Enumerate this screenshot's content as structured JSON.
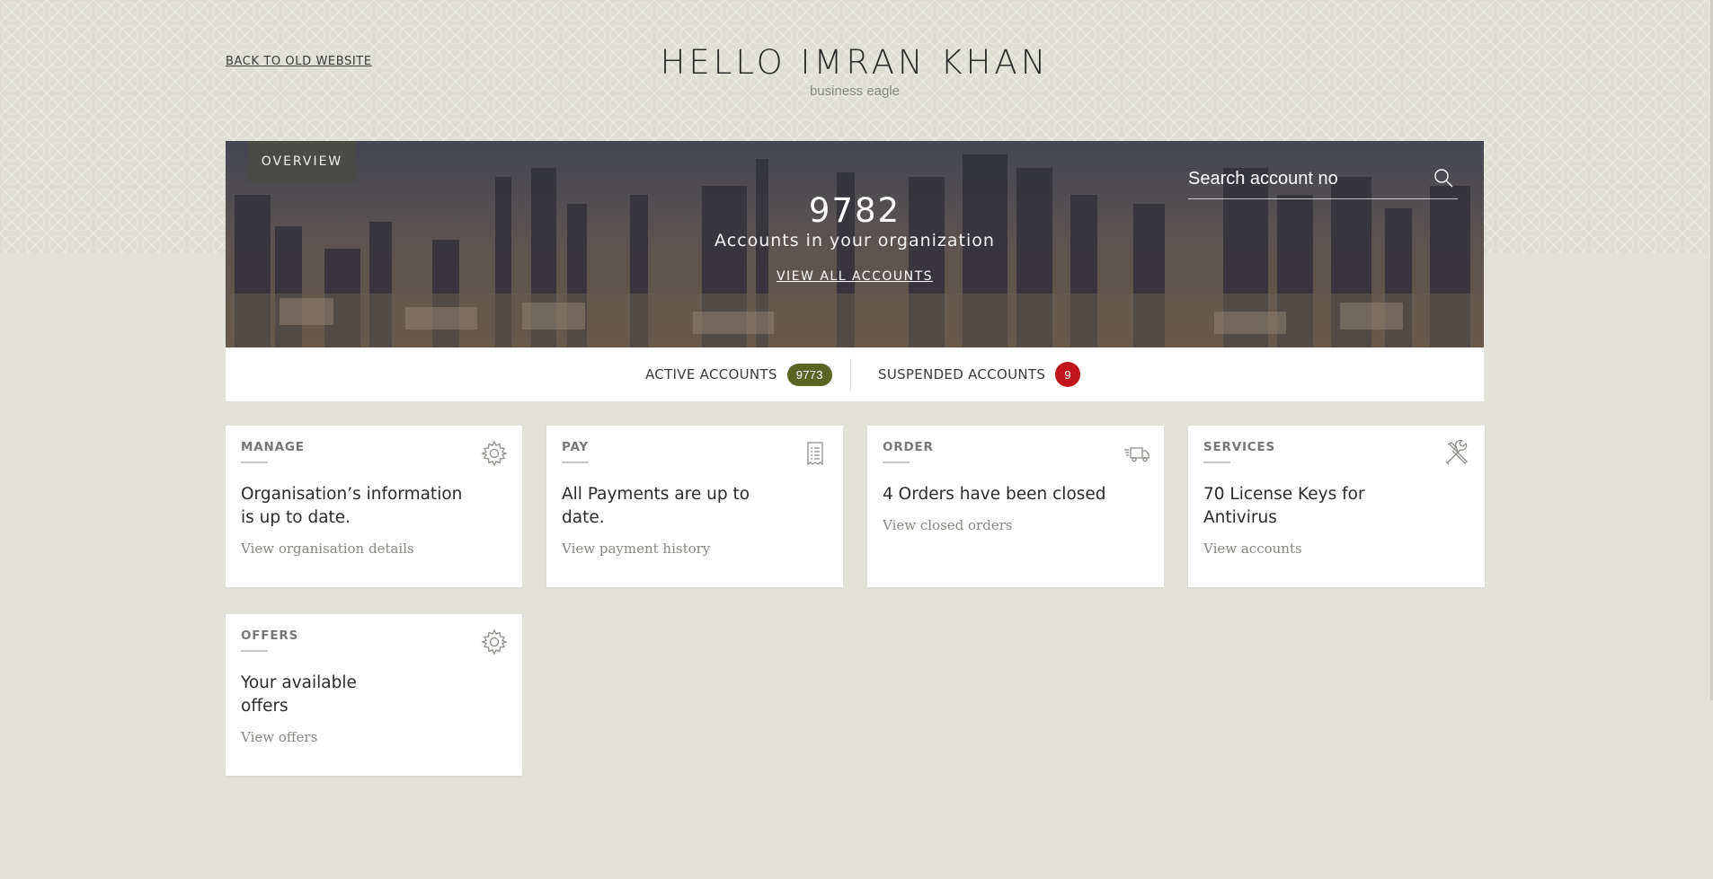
{
  "header": {
    "back_link": "BACK TO OLD WEBSITE",
    "greeting": "HELLO IMRAN KHAN",
    "subtitle": "business eagle"
  },
  "hero": {
    "tab_label": "OVERVIEW",
    "account_count": "9782",
    "caption": "Accounts in your organization",
    "view_all_link": "VIEW ALL ACCOUNTS",
    "search": {
      "placeholder": "Search account no",
      "icon": "search-icon"
    }
  },
  "status": {
    "active": {
      "label": "ACTIVE ACCOUNTS",
      "count": "9773",
      "color": "#5a6425"
    },
    "suspended": {
      "label": "SUSPENDED ACCOUNTS",
      "count": "9",
      "color": "#c0161b"
    }
  },
  "cards": {
    "manage": {
      "label": "MANAGE",
      "icon": "gear-icon",
      "headline": "Organisation’s information is up to date.",
      "action": "View organisation details"
    },
    "pay": {
      "label": "PAY",
      "icon": "receipt-icon",
      "headline": "All Payments are up to date.",
      "action": "View payment history"
    },
    "order": {
      "label": "ORDER",
      "icon": "truck-icon",
      "headline": "4 Orders have been closed",
      "action": "View closed orders"
    },
    "services": {
      "label": "SERVICES",
      "icon": "tools-icon",
      "headline": "70 License Keys for Antivirus",
      "action": "View accounts"
    },
    "offers": {
      "label": "OFFERS",
      "icon": "gear-icon",
      "headline": "Your available offers",
      "action": "View offers"
    }
  }
}
